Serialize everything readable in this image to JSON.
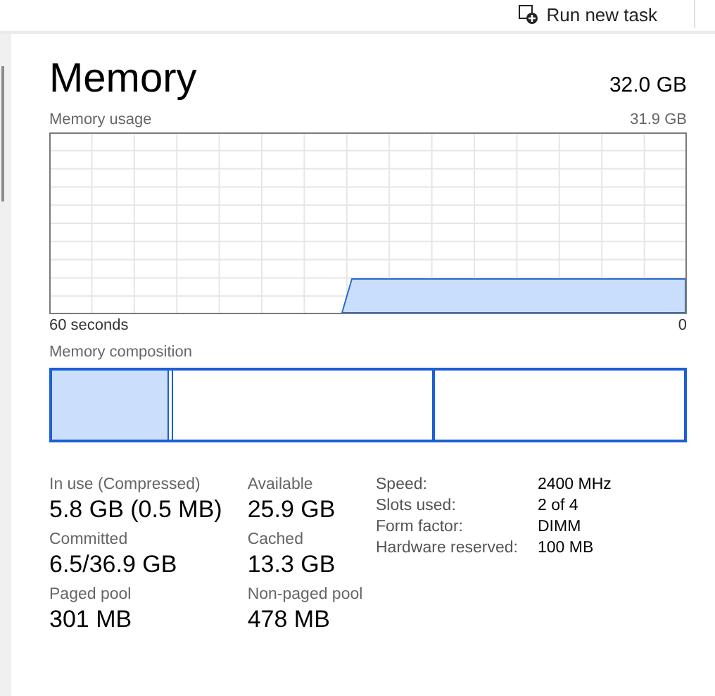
{
  "toolbar": {
    "run_task_button": "Run new task"
  },
  "header": {
    "title": "Memory",
    "total": "32.0 GB"
  },
  "usage_graph": {
    "label": "Memory usage",
    "max": "31.9 GB",
    "x_start": "60 seconds",
    "x_end": "0"
  },
  "composition": {
    "label": "Memory composition"
  },
  "stats": [
    {
      "label": "In use (Compressed)",
      "value": "5.8 GB (0.5 MB)"
    },
    {
      "label": "Available",
      "value": "25.9 GB"
    },
    {
      "label": "Committed",
      "value": "6.5/36.9 GB"
    },
    {
      "label": "Cached",
      "value": "13.3 GB"
    },
    {
      "label": "Paged pool",
      "value": "301 MB"
    },
    {
      "label": "Non-paged pool",
      "value": "478 MB"
    }
  ],
  "details": [
    {
      "label": "Speed:",
      "value": "2400 MHz"
    },
    {
      "label": "Slots used:",
      "value": "2 of 4"
    },
    {
      "label": "Form factor:",
      "value": "DIMM"
    },
    {
      "label": "Hardware reserved:",
      "value": "100 MB"
    }
  ]
}
